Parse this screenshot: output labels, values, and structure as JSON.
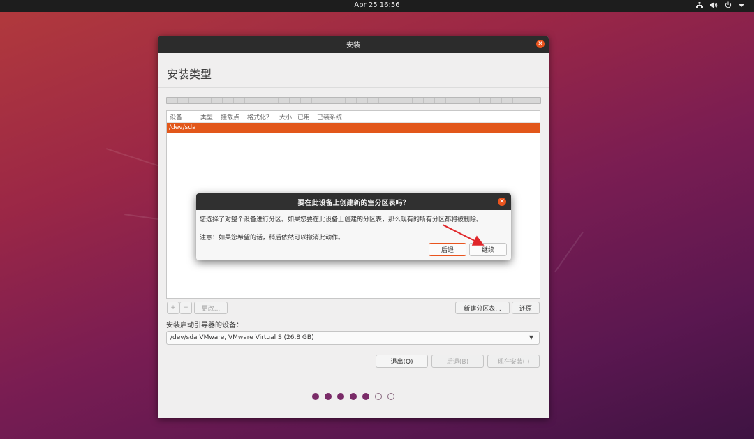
{
  "topbar": {
    "clock": "Apr 25  16:56"
  },
  "window": {
    "title": "安装",
    "heading": "安装类型",
    "table": {
      "columns": [
        "设备",
        "类型",
        "挂载点",
        "格式化？",
        "大小",
        "已用",
        "已装系统"
      ],
      "rows": [
        {
          "device": "/dev/sda"
        }
      ]
    },
    "tools": {
      "add": "+",
      "remove": "−",
      "change": "更改...",
      "new_table": "新建分区表...",
      "revert": "还原"
    },
    "boot_label": "安装启动引导器的设备：",
    "boot_device": "/dev/sda VMware, VMware Virtual S (26.8 GB)",
    "buttons": {
      "quit": "退出(Q)",
      "back": "后退(B)",
      "install_now": "现在安装(I)"
    },
    "progress": {
      "total": 7,
      "done": 5
    }
  },
  "dialog": {
    "title": "要在此设备上创建新的空分区表吗？",
    "message1": "您选择了对整个设备进行分区。如果您要在此设备上创建的分区表，那么现有的所有分区都将被删除。",
    "message2": "注意：如果您希望的话，稍后依然可以撤消此动作。",
    "back_label": "后退",
    "continue_label": "继续"
  },
  "colors": {
    "accent": "#e9541e",
    "selection": "#e2571a",
    "annotation_arrow": "#e0262a"
  }
}
